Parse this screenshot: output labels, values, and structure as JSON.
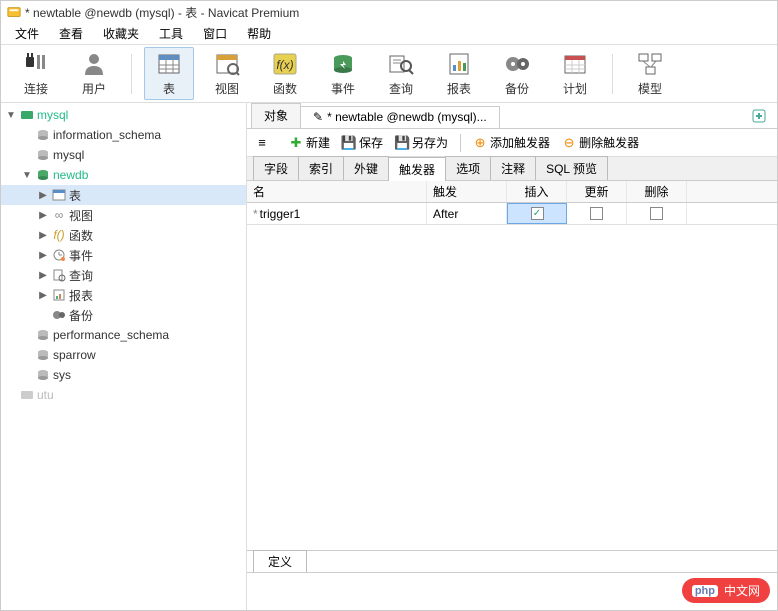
{
  "window": {
    "title": "* newtable @newdb (mysql) - 表 - Navicat Premium"
  },
  "menu": {
    "items": [
      "文件",
      "查看",
      "收藏夹",
      "工具",
      "窗口",
      "帮助"
    ]
  },
  "toolbar": {
    "items": [
      {
        "label": "连接",
        "icon": "plug"
      },
      {
        "label": "用户",
        "icon": "user"
      },
      {
        "label": "表",
        "icon": "table",
        "active": true
      },
      {
        "label": "视图",
        "icon": "view"
      },
      {
        "label": "函数",
        "icon": "func"
      },
      {
        "label": "事件",
        "icon": "event"
      },
      {
        "label": "查询",
        "icon": "query"
      },
      {
        "label": "报表",
        "icon": "report"
      },
      {
        "label": "备份",
        "icon": "backup"
      },
      {
        "label": "计划",
        "icon": "schedule"
      },
      {
        "label": "模型",
        "icon": "model"
      }
    ]
  },
  "tree": {
    "nodes": [
      {
        "depth": 0,
        "expand": "▼",
        "icon": "conn",
        "label": "mysql",
        "color": "#2b8"
      },
      {
        "depth": 1,
        "expand": "",
        "icon": "db",
        "label": "information_schema"
      },
      {
        "depth": 1,
        "expand": "",
        "icon": "db",
        "label": "mysql"
      },
      {
        "depth": 1,
        "expand": "▼",
        "icon": "dbopen",
        "label": "newdb",
        "color": "#2b8"
      },
      {
        "depth": 2,
        "expand": "▶",
        "icon": "table",
        "label": "表",
        "sel": true
      },
      {
        "depth": 2,
        "expand": "▶",
        "icon": "view",
        "label": "视图"
      },
      {
        "depth": 2,
        "expand": "▶",
        "icon": "func",
        "label": "函数"
      },
      {
        "depth": 2,
        "expand": "▶",
        "icon": "event",
        "label": "事件"
      },
      {
        "depth": 2,
        "expand": "▶",
        "icon": "query",
        "label": "查询"
      },
      {
        "depth": 2,
        "expand": "▶",
        "icon": "report",
        "label": "报表"
      },
      {
        "depth": 2,
        "expand": "",
        "icon": "backup",
        "label": "备份"
      },
      {
        "depth": 1,
        "expand": "",
        "icon": "db",
        "label": "performance_schema"
      },
      {
        "depth": 1,
        "expand": "",
        "icon": "db",
        "label": "sparrow"
      },
      {
        "depth": 1,
        "expand": "",
        "icon": "db",
        "label": "sys"
      },
      {
        "depth": 0,
        "expand": "",
        "icon": "conn-off",
        "label": "utu",
        "color": "#bbb"
      }
    ]
  },
  "tabs": {
    "items": [
      {
        "label": "对象",
        "active": false
      },
      {
        "label": "* newtable @newdb (mysql)...",
        "active": true,
        "icon": "pencil"
      }
    ]
  },
  "actions": {
    "items": [
      {
        "label": "新建",
        "icon": "plus",
        "color": "#3a3"
      },
      {
        "label": "保存",
        "icon": "save",
        "color": "#555"
      },
      {
        "label": "另存为",
        "icon": "saveas",
        "color": "#555"
      },
      {
        "label": "添加触发器",
        "icon": "add",
        "color": "#e80",
        "prefix": true
      },
      {
        "label": "删除触发器",
        "icon": "del",
        "color": "#e80",
        "prefix": true
      }
    ]
  },
  "subtabs": {
    "items": [
      "字段",
      "索引",
      "外键",
      "触发器",
      "选项",
      "注释",
      "SQL 预览"
    ],
    "active": 3
  },
  "grid": {
    "columns": [
      "名",
      "触发",
      "插入",
      "更新",
      "删除"
    ],
    "rows": [
      {
        "mark": "*",
        "name": "trigger1",
        "trigger": "After",
        "insert": true,
        "update": false,
        "delete": false,
        "selcol": 2
      }
    ]
  },
  "bottom": {
    "tab": "定义"
  },
  "watermark": {
    "brand": "php",
    "text": "中文网"
  }
}
